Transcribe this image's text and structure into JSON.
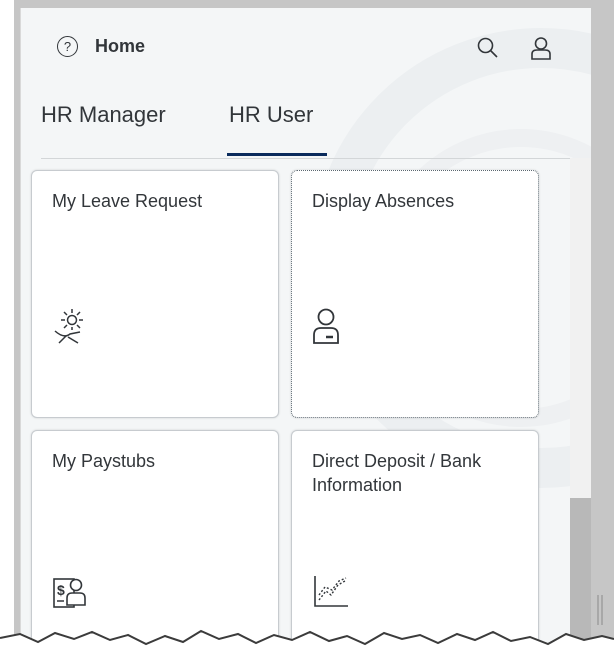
{
  "header": {
    "title": "Home",
    "help_icon": "help-icon",
    "search_icon": "search-icon",
    "user_icon": "user-icon"
  },
  "tabs": [
    {
      "label": "HR Manager",
      "selected": false
    },
    {
      "label": "HR User",
      "selected": true
    }
  ],
  "tiles": [
    {
      "title": "My Leave Request",
      "icon": "sun-chair-icon"
    },
    {
      "title": "Display Absences",
      "icon": "person-badge-icon",
      "focused": true
    },
    {
      "title": "My Paystubs",
      "icon": "paystub-icon"
    },
    {
      "title": "Direct Deposit / Bank Information",
      "icon": "line-chart-icon"
    }
  ],
  "colors": {
    "accent": "#0a2b5c",
    "text": "#32363a",
    "background": "#f4f6f7",
    "tile": "#ffffff"
  }
}
